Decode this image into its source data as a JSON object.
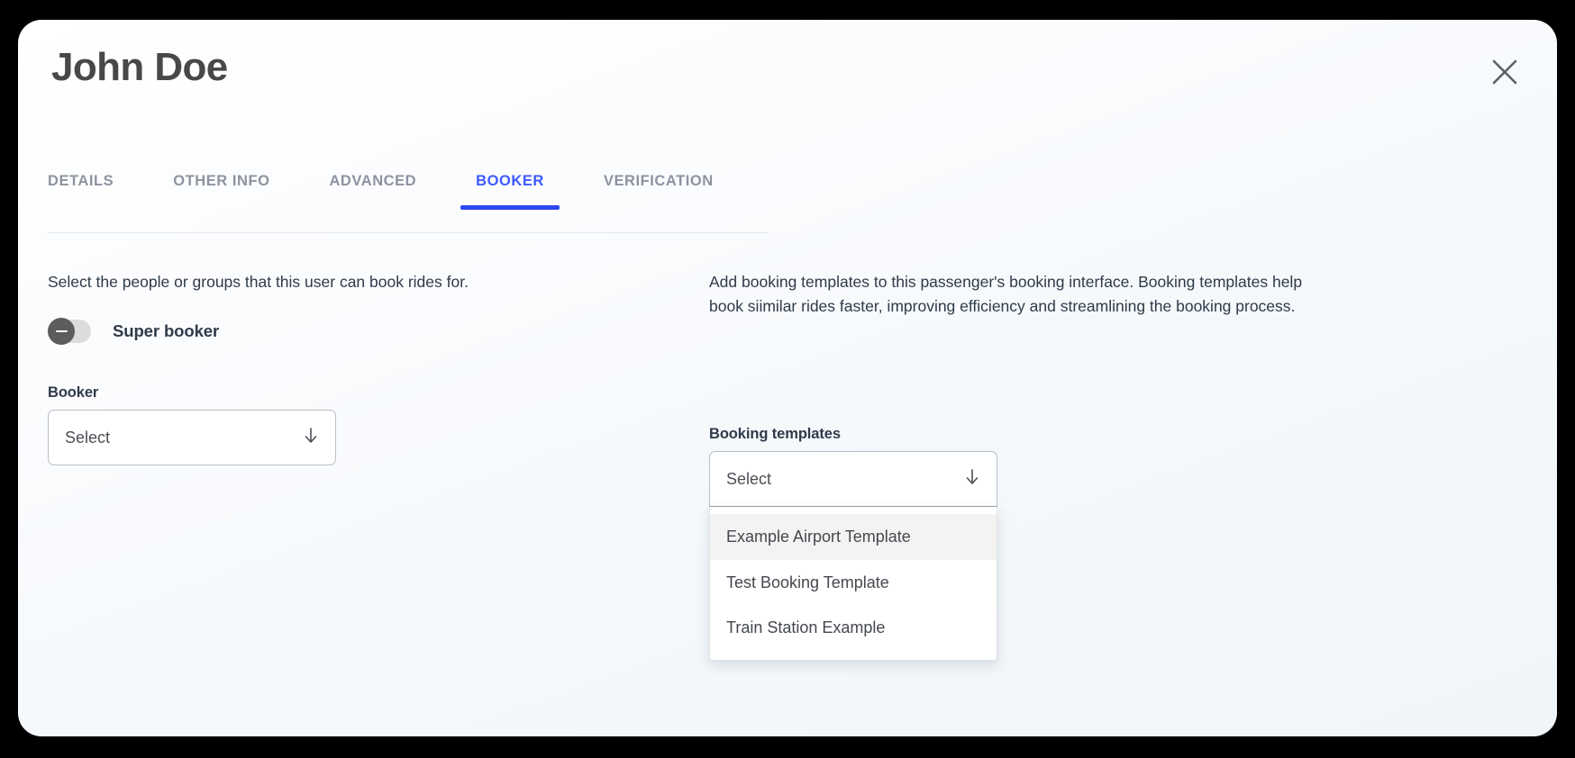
{
  "modal": {
    "title": "John Doe",
    "close_icon": "close-icon"
  },
  "tabs": [
    {
      "label": "DETAILS",
      "active": false
    },
    {
      "label": "OTHER INFO",
      "active": false
    },
    {
      "label": "ADVANCED",
      "active": false
    },
    {
      "label": "BOOKER",
      "active": true
    },
    {
      "label": "VERIFICATION",
      "active": false
    }
  ],
  "left_panel": {
    "description": "Select the people or groups that this user can book rides for.",
    "toggle": {
      "label": "Super booker",
      "state": "off"
    },
    "booker_field": {
      "label": "Booker",
      "value": "Select",
      "placeholder": "Select",
      "arrow_icon": "arrow-down-icon"
    }
  },
  "right_panel": {
    "description": "Add booking templates to this passenger's booking interface. Booking templates help book siimilar rides faster, improving efficiency and streamlining the booking process.",
    "templates_field": {
      "label": "Booking templates",
      "value": "Select",
      "placeholder": "Select",
      "arrow_icon": "arrow-down-icon",
      "expanded": true
    },
    "dropdown_options": [
      {
        "label": "Example Airport Template",
        "highlighted": true
      },
      {
        "label": "Test Booking Template",
        "highlighted": false
      },
      {
        "label": "Train Station Example",
        "highlighted": false
      }
    ]
  },
  "colors": {
    "accent": "#3d5afe",
    "accent_underline": "#2d48ef",
    "title": "#484848",
    "body_text": "#2f3a4a",
    "tab_inactive": "#8d93a0",
    "toggle_knob": "#5c5c5c",
    "toggle_track": "#dcdcdc",
    "highlight": "#f3f3f3"
  }
}
